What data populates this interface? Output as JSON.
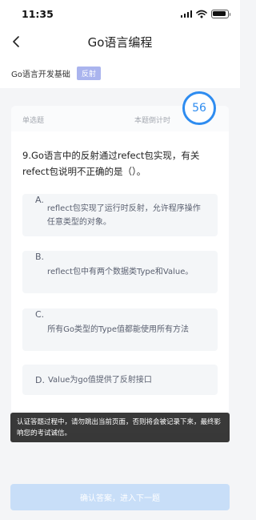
{
  "status_bar": {
    "time": "11:35",
    "battery_level": 0.9
  },
  "nav": {
    "title": "Go语言编程",
    "back_icon": "chevron-left-icon"
  },
  "subject": {
    "name": "Go语言开发基础",
    "tag": "反射"
  },
  "question": {
    "type_label": "单选题",
    "countdown_label": "本题倒计时",
    "countdown_value": "56",
    "text": "9.Go语言中的反射通过refect包实现，有关refect包说明不正确的是（）。",
    "options": [
      {
        "letter": "A.",
        "text": "reflect包实现了运行时反射，允许程序操作任意类型的对象。"
      },
      {
        "letter": "B.",
        "text": "reflect包中有两个数据类Type和Value。"
      },
      {
        "letter": "C.",
        "text": "所有Go类型的Type值都能使用所有方法"
      },
      {
        "letter": "D.",
        "text": "Value为go值提供了反射接口"
      }
    ]
  },
  "toast": {
    "text": "认证答题过程中，请勿跳出当前页面，否则将会被记录下来，最终影响您的考试诚信。"
  },
  "footer": {
    "confirm_label": "确认答案，进入下一题"
  },
  "colors": {
    "accent": "#2e8cf0",
    "tag_bg": "#aab4ee",
    "button_disabled": "#c8def8"
  }
}
